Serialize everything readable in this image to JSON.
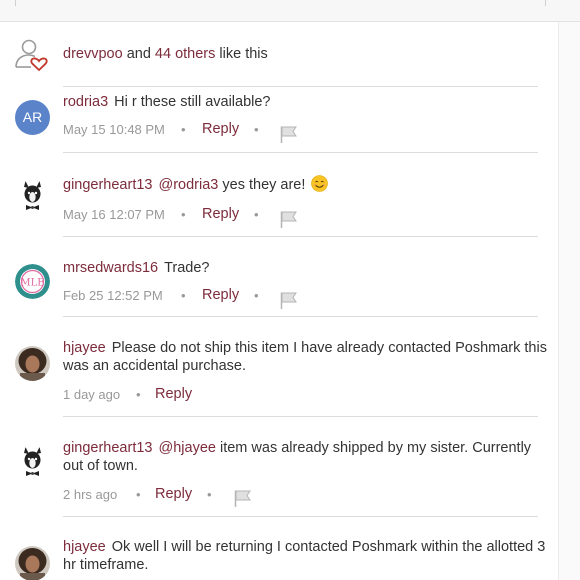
{
  "likes": {
    "user": "drevvpoo",
    "connector": "and",
    "count_text": "44 others",
    "suffix": "like this"
  },
  "comments": [
    {
      "user": "rodria3",
      "avatar_initials": "AR",
      "avatar_color": "#5b83c9",
      "mention": "",
      "text": "Hi r these still available?",
      "time": "May 15 10:48 PM",
      "reply_label": "Reply"
    },
    {
      "user": "gingerheart13",
      "mention": "@rodria3",
      "text": " yes they are!",
      "emoji": "smiling-face",
      "time": "May 16 12:07 PM",
      "reply_label": "Reply"
    },
    {
      "user": "mrsedwards16",
      "avatar_initials": "MLE",
      "mention": "",
      "text": "Trade?",
      "time": "Feb 25 12:52 PM",
      "reply_label": "Reply"
    },
    {
      "user": "hjayee",
      "mention": "",
      "text": "Please do not ship this item I have already contacted Poshmark this was an accidental purchase.",
      "time": "1 day ago",
      "reply_label": "Reply"
    },
    {
      "user": "gingerheart13",
      "mention": "@hjayee",
      "text": " item was already shipped by my sister. Currently out of town.",
      "time": "2 hrs ago",
      "reply_label": "Reply"
    },
    {
      "user": "hjayee",
      "mention": "",
      "text": "Ok well I will be returning I contacted Poshmark within the allotted 3 hr timeframe."
    }
  ],
  "meta_separator": "•",
  "colors": {
    "brand": "#7d2c3b",
    "muted": "#999999",
    "divider": "#dcdcdc"
  },
  "icons": {
    "like": "user-heart-icon",
    "flag": "flag-icon"
  }
}
